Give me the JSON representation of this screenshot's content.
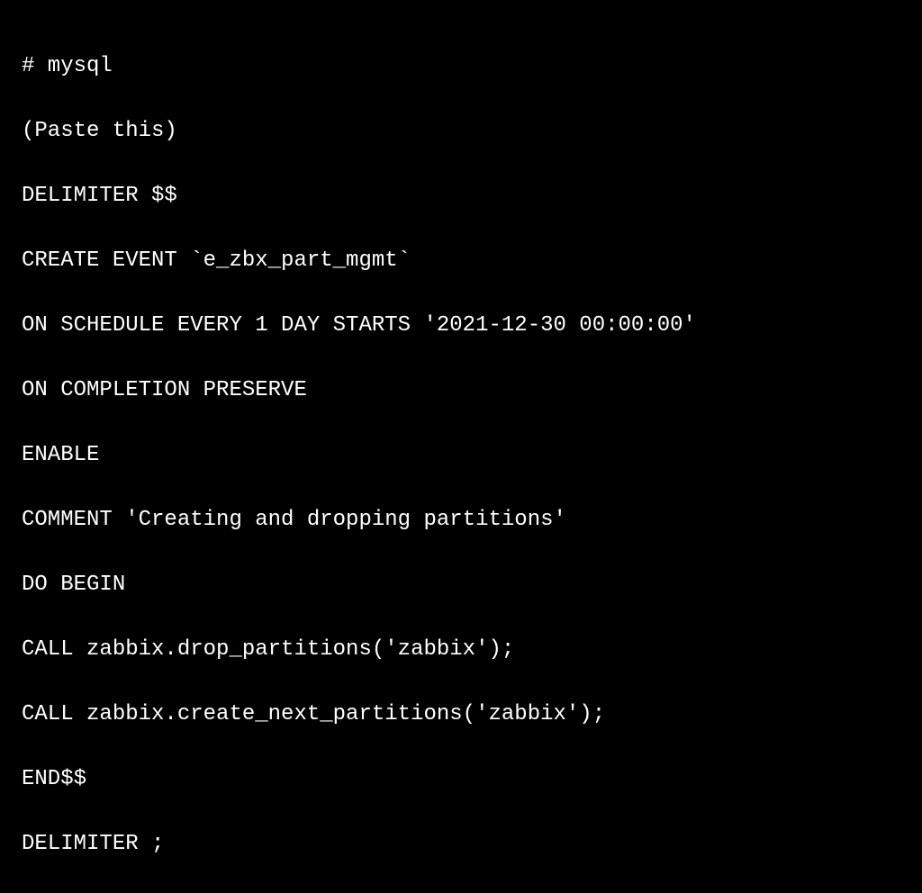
{
  "code": {
    "lines": [
      "# mysql",
      "(Paste this)",
      "DELIMITER $$",
      "CREATE EVENT `e_zbx_part_mgmt`",
      "ON SCHEDULE EVERY 1 DAY STARTS '2021-12-30 00:00:00'",
      "ON COMPLETION PRESERVE",
      "ENABLE",
      "COMMENT 'Creating and dropping partitions'",
      "DO BEGIN",
      "CALL zabbix.drop_partitions('zabbix');",
      "CALL zabbix.create_next_partitions('zabbix');",
      "END$$",
      "DELIMITER ;"
    ]
  }
}
